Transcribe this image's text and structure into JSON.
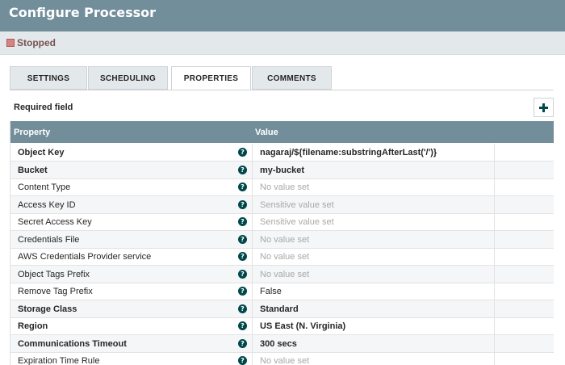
{
  "dialog": {
    "title": "Configure Processor"
  },
  "status": {
    "label": "Stopped"
  },
  "tabs": [
    {
      "label": "SETTINGS"
    },
    {
      "label": "SCHEDULING"
    },
    {
      "label": "PROPERTIES"
    },
    {
      "label": "COMMENTS"
    }
  ],
  "required_label": "Required field",
  "add_button": {
    "icon": "plus-icon"
  },
  "table": {
    "headers": {
      "property": "Property",
      "value": "Value"
    },
    "rows": [
      {
        "name": "Object Key",
        "value": "nagaraj/${filename:substringAfterLast('/')}",
        "required": true,
        "muted": false
      },
      {
        "name": "Bucket",
        "value": "my-bucket",
        "required": true,
        "muted": false
      },
      {
        "name": "Content Type",
        "value": "No value set",
        "required": false,
        "muted": true
      },
      {
        "name": "Access Key ID",
        "value": "Sensitive value set",
        "required": false,
        "muted": true
      },
      {
        "name": "Secret Access Key",
        "value": "Sensitive value set",
        "required": false,
        "muted": true
      },
      {
        "name": "Credentials File",
        "value": "No value set",
        "required": false,
        "muted": true
      },
      {
        "name": "AWS Credentials Provider service",
        "value": "No value set",
        "required": false,
        "muted": true
      },
      {
        "name": "Object Tags Prefix",
        "value": "No value set",
        "required": false,
        "muted": true
      },
      {
        "name": "Remove Tag Prefix",
        "value": "False",
        "required": false,
        "muted": false
      },
      {
        "name": "Storage Class",
        "value": "Standard",
        "required": true,
        "muted": false
      },
      {
        "name": "Region",
        "value": "US East (N. Virginia)",
        "required": true,
        "muted": false
      },
      {
        "name": "Communications Timeout",
        "value": "300 secs",
        "required": true,
        "muted": false
      },
      {
        "name": "Expiration Time Rule",
        "value": "No value set",
        "required": false,
        "muted": true
      }
    ]
  },
  "colors": {
    "header": "#728e9b",
    "accent": "#004849",
    "stopped": "#d18686"
  }
}
